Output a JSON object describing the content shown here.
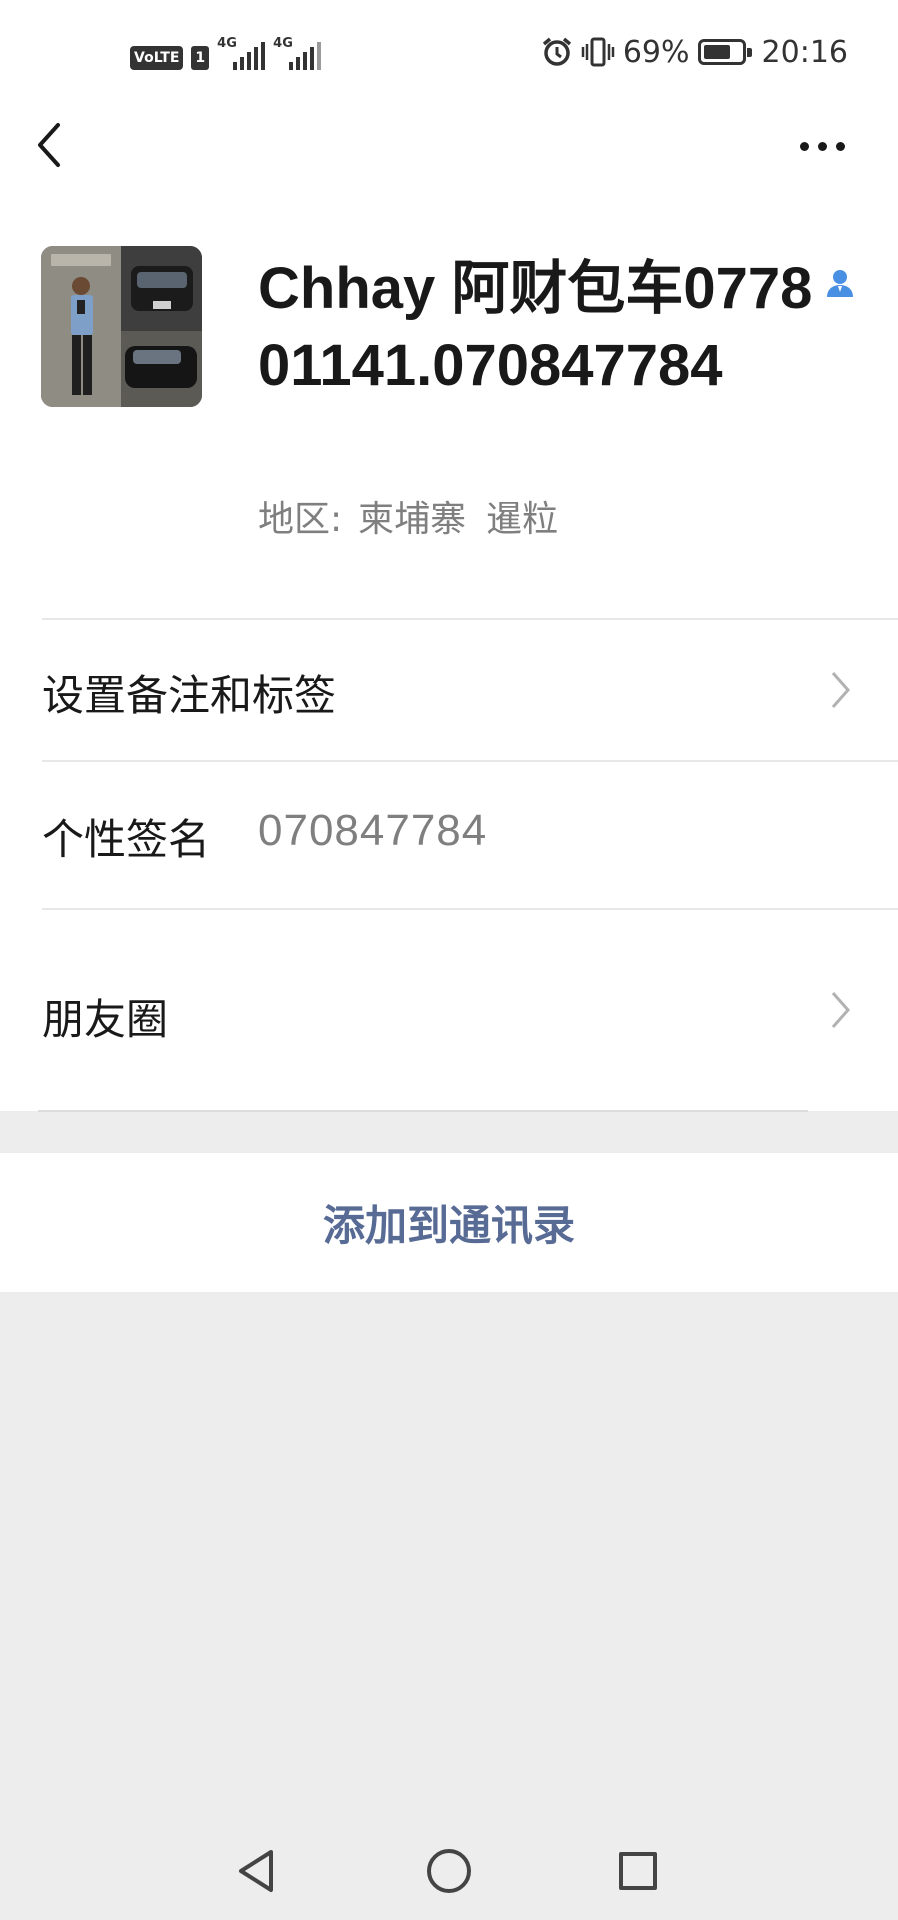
{
  "status_bar": {
    "volte": "VoLTE",
    "sim": "1",
    "network_1": "4G",
    "network_2": "4G",
    "battery": "69%",
    "time": "20:16"
  },
  "nav": {
    "back_icon": "back-arrow-icon",
    "more_icon": "more-horizontal-icon"
  },
  "profile": {
    "name": "Chhay 阿财包车077801141.070847784",
    "region_label": "地区:",
    "region_country": "柬埔寨",
    "region_city": "暹粒",
    "badge_icon": "user-icon"
  },
  "rows": {
    "remark_label": "设置备注和标签",
    "signature_label": "个性签名",
    "signature_value": "070847784",
    "moments_label": "朋友圈"
  },
  "actions": {
    "add_contact": "添加到通讯录"
  },
  "colors": {
    "link_blue": "#576b95",
    "badge_blue": "#4a90e2",
    "background": "#ededed",
    "secondary_text": "#7f7f7f"
  }
}
